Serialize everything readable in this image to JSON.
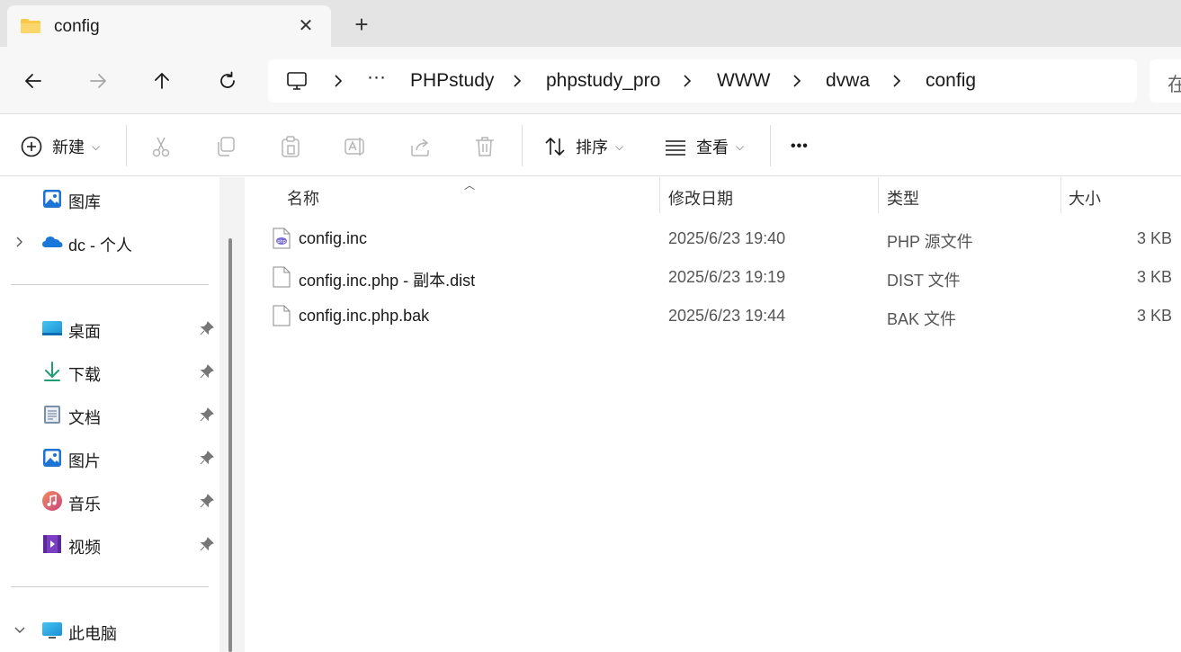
{
  "tab": {
    "title": "config",
    "close": "✕",
    "new": "+"
  },
  "breadcrumb": {
    "overflow": "···",
    "items": [
      "PHPstudy",
      "phpstudy_pro",
      "WWW",
      "dvwa",
      "config"
    ]
  },
  "search": {
    "placeholder": "在"
  },
  "toolbar": {
    "new_label": "新建",
    "sort_label": "排序",
    "view_label": "查看",
    "more_label": "•••"
  },
  "sidebar": {
    "top_items": [
      {
        "label": "图库",
        "icon": "gallery-icon"
      },
      {
        "label": "dc - 个人",
        "icon": "onedrive-icon"
      }
    ],
    "quick_access": [
      {
        "label": "桌面",
        "icon": "desktop-icon"
      },
      {
        "label": "下载",
        "icon": "download-icon"
      },
      {
        "label": "文档",
        "icon": "documents-icon"
      },
      {
        "label": "图片",
        "icon": "pictures-icon"
      },
      {
        "label": "音乐",
        "icon": "music-icon"
      },
      {
        "label": "视频",
        "icon": "videos-icon"
      }
    ],
    "this_pc": {
      "label": "此电脑",
      "icon": "this-pc-icon"
    }
  },
  "columns": {
    "name": "名称",
    "date": "修改日期",
    "type": "类型",
    "size": "大小"
  },
  "files": [
    {
      "name": "config.inc",
      "date": "2025/6/23 19:40",
      "type": "PHP 源文件",
      "size": "3 KB",
      "icon": "php-file-icon"
    },
    {
      "name": "config.inc.php - 副本.dist",
      "date": "2025/6/23 19:19",
      "type": "DIST 文件",
      "size": "3 KB",
      "icon": "blank-file-icon"
    },
    {
      "name": "config.inc.php.bak",
      "date": "2025/6/23 19:44",
      "type": "BAK 文件",
      "size": "3 KB",
      "icon": "blank-file-icon"
    }
  ],
  "colors": {
    "folder": "#f8c94b",
    "accent": "#005fb8",
    "php": "#7a6fd0"
  }
}
